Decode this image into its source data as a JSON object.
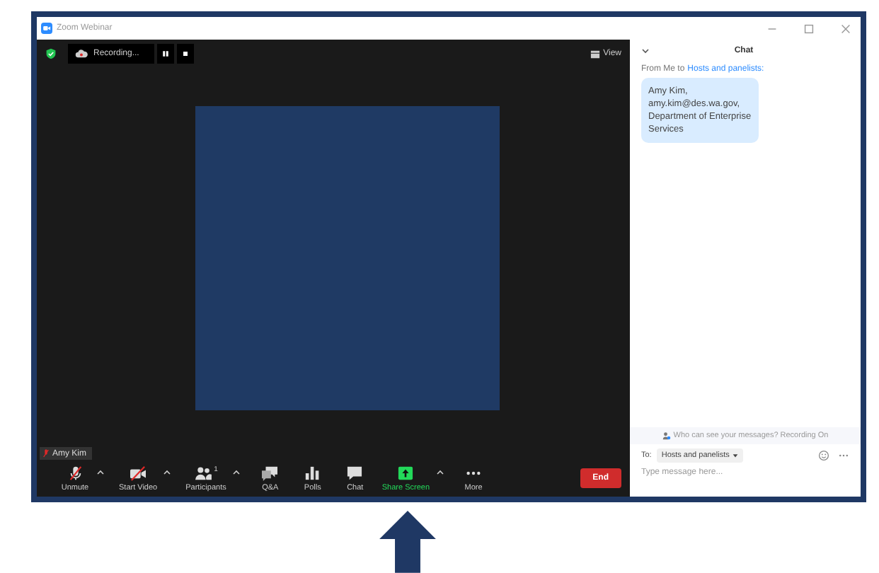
{
  "window": {
    "title": "Zoom Webinar"
  },
  "meeting": {
    "recording": {
      "label": "Recording..."
    },
    "view_button": "View",
    "participant_name": "Amy Kim",
    "toolbar": [
      {
        "kind": "mic",
        "label": "Unmute",
        "caret": true
      },
      {
        "kind": "video",
        "label": "Start Video",
        "caret": true
      },
      {
        "kind": "participants",
        "label": "Participants",
        "count": "1",
        "caret": true
      },
      {
        "kind": "qa",
        "label": "Q&A",
        "caret": false
      },
      {
        "kind": "polls",
        "label": "Polls",
        "caret": false
      },
      {
        "kind": "chat",
        "label": "Chat",
        "caret": false
      },
      {
        "kind": "share",
        "label": "Share Screen",
        "caret": true
      },
      {
        "kind": "more",
        "label": "More",
        "caret": false
      }
    ],
    "end_button": "End"
  },
  "chat": {
    "title": "Chat",
    "from": "From Me to",
    "recipient_link": "Hosts and panelists:",
    "message": [
      "Amy Kim,",
      "amy.kim@des.wa.gov,",
      "Department of Enterprise",
      "Services"
    ],
    "notice": "Who can see your messages? Recording On",
    "to_label": "To:",
    "to_value": "Hosts and panelists",
    "placeholder": "Type message here..."
  }
}
